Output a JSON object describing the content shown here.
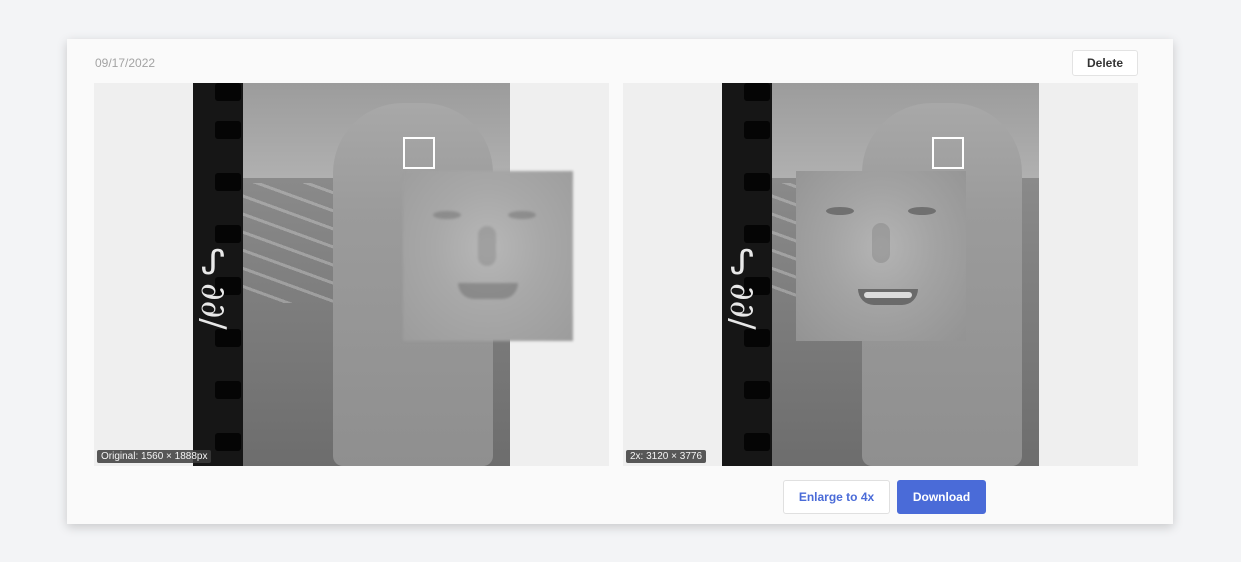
{
  "card": {
    "date": "09/17/2022",
    "delete_label": "Delete"
  },
  "original": {
    "size_label": "Original: 1560 × 1888px"
  },
  "upscaled": {
    "size_label": "2x: 3120 × 3776"
  },
  "actions": {
    "enlarge_label": "Enlarge to 4x",
    "download_label": "Download"
  },
  "colors": {
    "accent": "#4a6bd8",
    "background": "#f3f4f6",
    "card": "#fafafa"
  }
}
